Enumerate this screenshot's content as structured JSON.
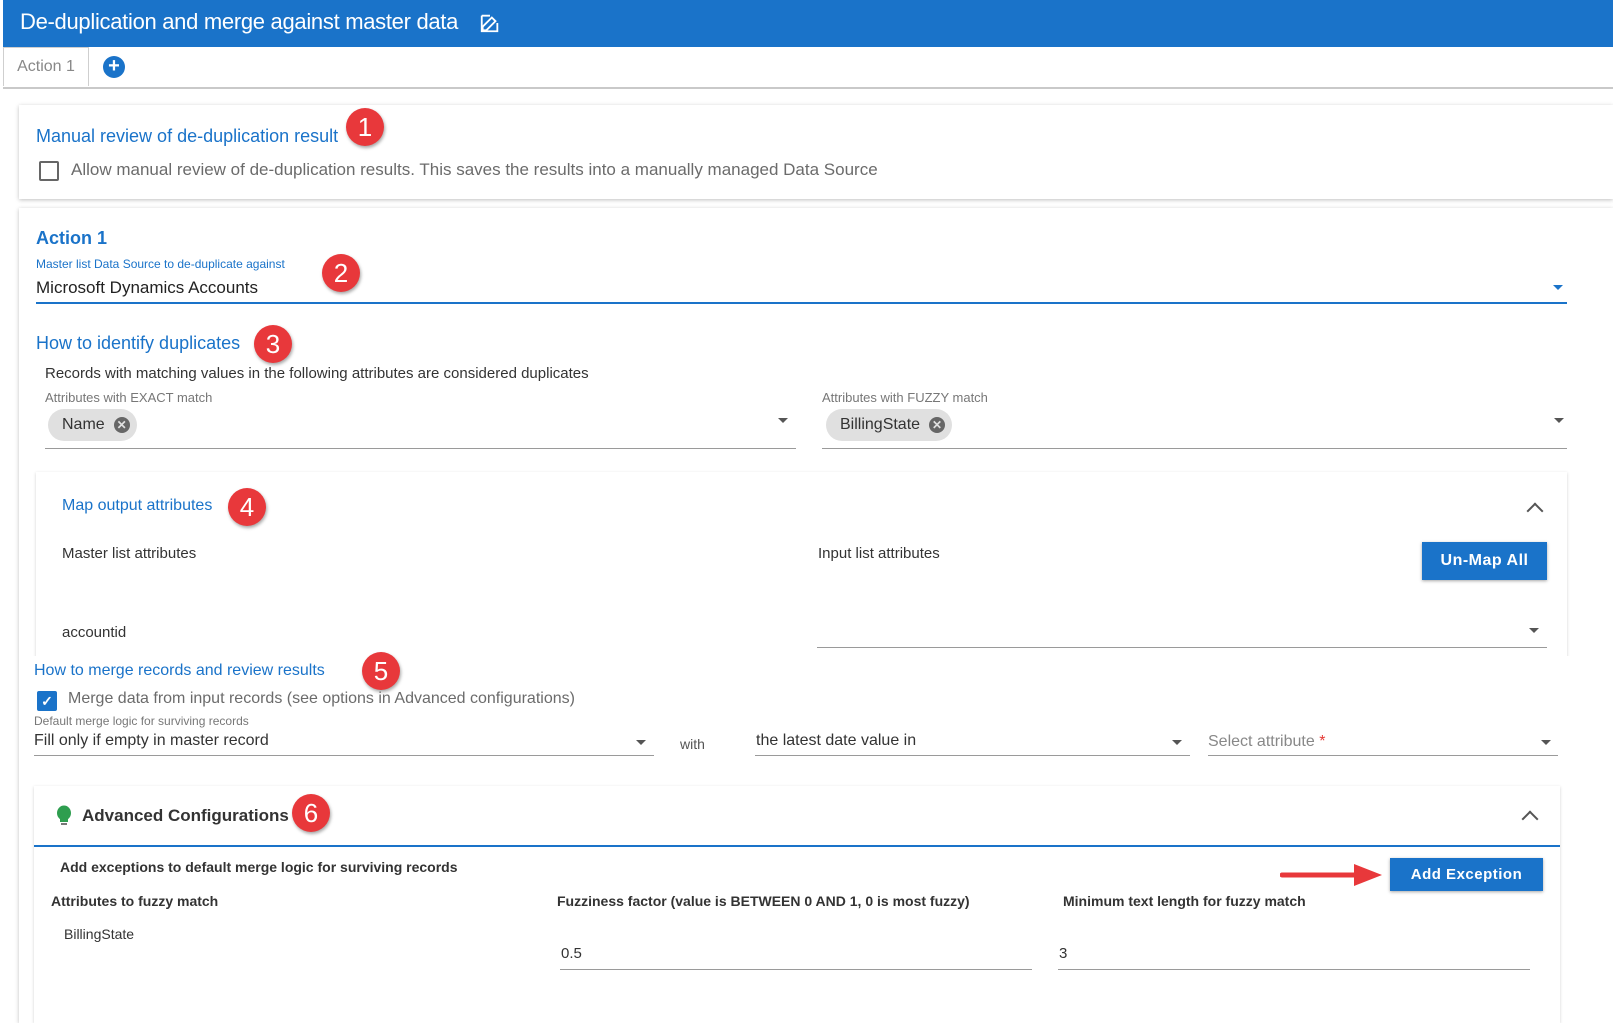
{
  "header": {
    "title": "De-duplication and merge against master data",
    "edit_icon": "edit-icon"
  },
  "tabs": [
    {
      "label": "Action 1"
    }
  ],
  "manual_review": {
    "heading": "Manual review of de-duplication result",
    "checkbox_label": "Allow manual review of de-duplication results. This saves the results into a manually managed Data Source",
    "checked": false
  },
  "action": {
    "title": "Action 1",
    "master_label": "Master list Data Source to de-duplicate against",
    "master_value": "Microsoft Dynamics Accounts"
  },
  "identify": {
    "heading": "How to identify duplicates",
    "description": "Records with matching values in the following attributes are considered duplicates",
    "exact_label": "Attributes with EXACT match",
    "exact_chips": [
      "Name"
    ],
    "fuzzy_label": "Attributes with FUZZY match",
    "fuzzy_chips": [
      "BillingState"
    ]
  },
  "map_output": {
    "heading": "Map output attributes",
    "master_col": "Master list attributes",
    "input_col": "Input list attributes",
    "unmap_button": "Un-Map All",
    "row_attr": "accountid",
    "row_input_value": ""
  },
  "merge": {
    "heading": "How to merge records and review results",
    "checkbox_label": "Merge data from input records (see options in Advanced configurations)",
    "checked": true,
    "logic_label": "Default merge logic for surviving records",
    "logic_value": "Fill only if empty in master record",
    "with_label": "with",
    "date_value": "the latest date value in",
    "attr_placeholder": "Select attribute",
    "required_mark": "*"
  },
  "advanced": {
    "title": "Advanced Configurations",
    "icon": "lightbulb-icon",
    "exceptions_label": "Add exceptions to default merge logic for surviving records",
    "add_button": "Add Exception",
    "col_fuzzy": "Attributes to fuzzy match",
    "col_factor": "Fuzziness factor (value is BETWEEN 0 AND 1, 0 is most fuzzy)",
    "col_minlen": "Minimum text length for fuzzy match",
    "row_attr": "BillingState",
    "row_factor": "0.5",
    "row_minlen": "3"
  },
  "badges": [
    "1",
    "2",
    "3",
    "4",
    "5",
    "6"
  ],
  "colors": {
    "accent": "#1a73c9",
    "badge": "#e8383b",
    "lightbulb": "#2e9e4f"
  }
}
